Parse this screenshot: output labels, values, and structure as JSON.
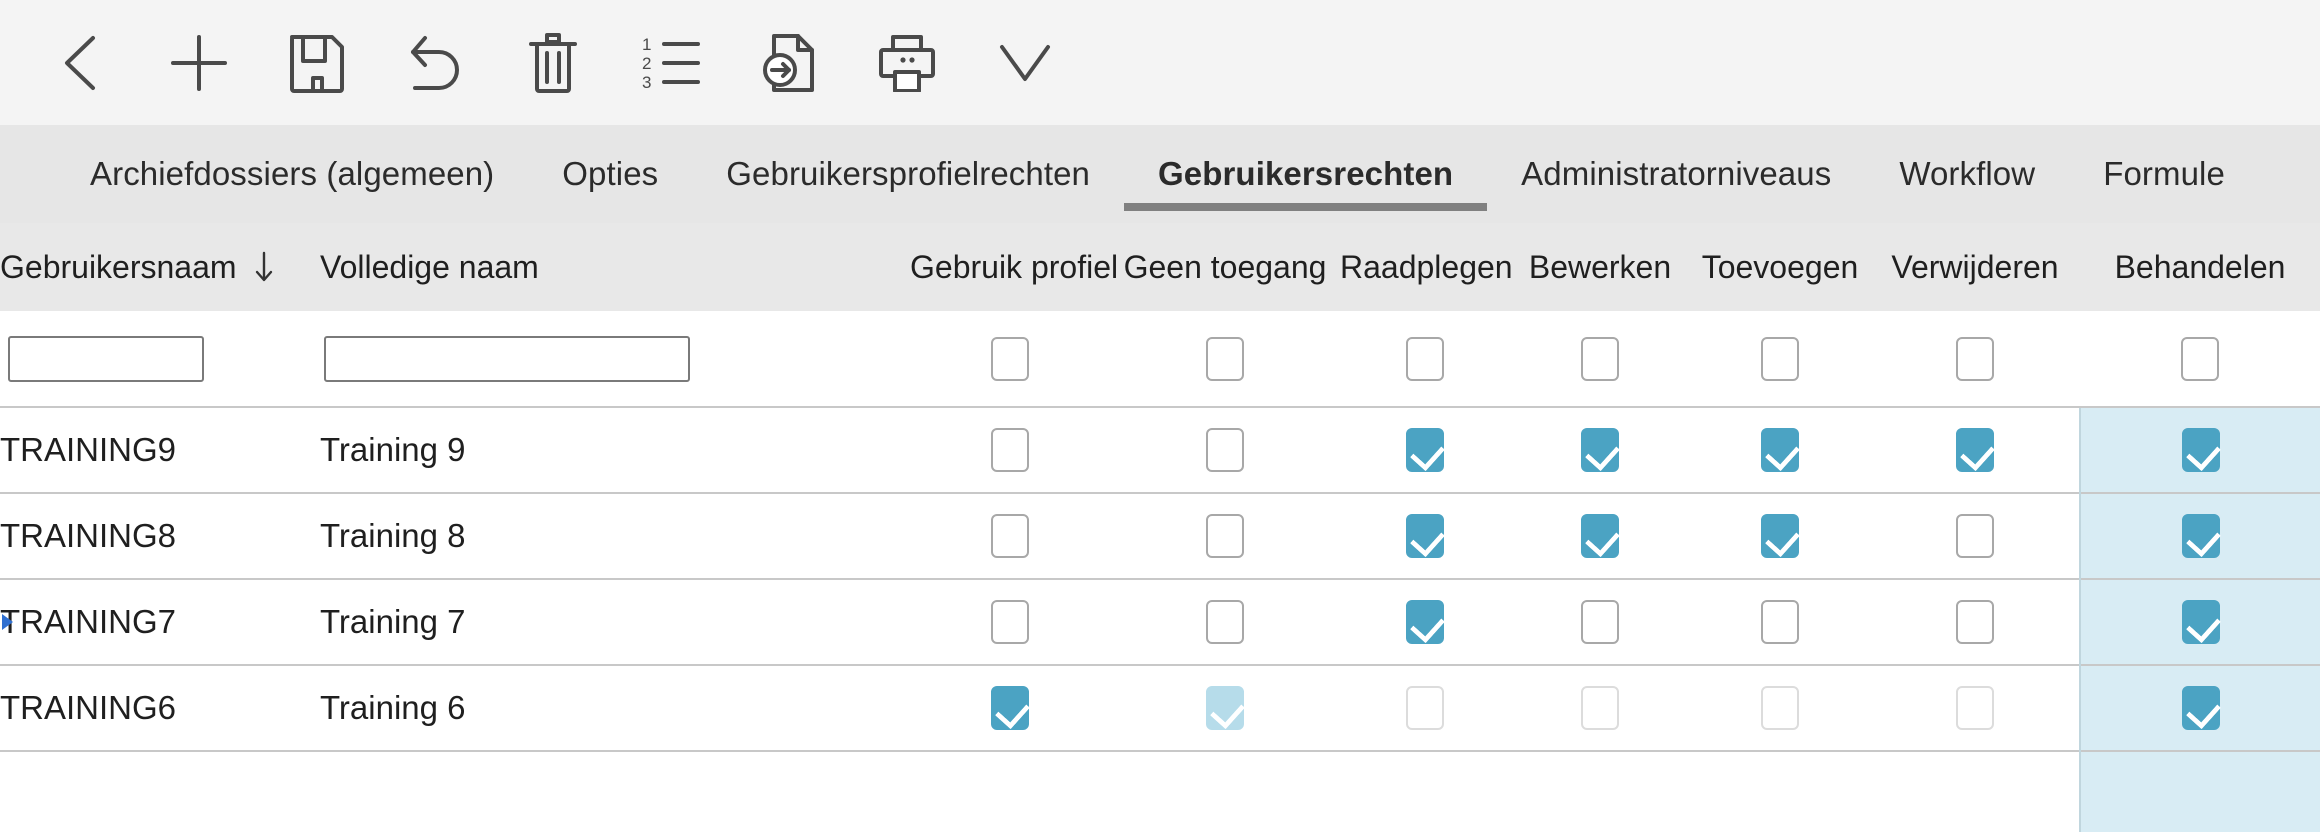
{
  "toolbar": {
    "buttons": [
      {
        "name": "back-icon",
        "title": "Terug"
      },
      {
        "name": "add-icon",
        "title": "Toevoegen"
      },
      {
        "name": "save-icon",
        "title": "Opslaan"
      },
      {
        "name": "undo-icon",
        "title": "Ongedaan maken"
      },
      {
        "name": "trash-icon",
        "title": "Verwijderen"
      },
      {
        "name": "numbered-list-icon",
        "title": "Nummering"
      },
      {
        "name": "export-document-icon",
        "title": "Exporteren"
      },
      {
        "name": "print-icon",
        "title": "Afdrukken"
      },
      {
        "name": "chevron-down-icon",
        "title": "Meer"
      }
    ]
  },
  "tabs": [
    {
      "label": "Archiefdossiers (algemeen)",
      "active": false
    },
    {
      "label": "Opties",
      "active": false
    },
    {
      "label": "Gebruikersprofielrechten",
      "active": false
    },
    {
      "label": "Gebruikersrechten",
      "active": true
    },
    {
      "label": "Administratorniveaus",
      "active": false
    },
    {
      "label": "Workflow",
      "active": false
    },
    {
      "label": "Formule",
      "active": false
    }
  ],
  "grid": {
    "columns": [
      {
        "key": "username",
        "label": "Gebruikersnaam",
        "type": "text",
        "sort": "desc"
      },
      {
        "key": "fullname",
        "label": "Volledige naam",
        "type": "text",
        "sort": null
      },
      {
        "key": "profile",
        "label": "Gebruik profiel",
        "type": "checkbox",
        "selected": false
      },
      {
        "key": "noaccess",
        "label": "Geen toegang",
        "type": "checkbox",
        "selected": false
      },
      {
        "key": "consult",
        "label": "Raadplegen",
        "type": "checkbox",
        "selected": false
      },
      {
        "key": "edit",
        "label": "Bewerken",
        "type": "checkbox",
        "selected": false
      },
      {
        "key": "add",
        "label": "Toevoegen",
        "type": "checkbox",
        "selected": false
      },
      {
        "key": "delete",
        "label": "Verwijderen",
        "type": "checkbox",
        "selected": false
      },
      {
        "key": "handle",
        "label": "Behandelen",
        "type": "checkbox",
        "selected": true
      }
    ],
    "filter_row": {
      "username_value": "",
      "username_placeholder": "",
      "fullname_value": "",
      "fullname_placeholder": "",
      "checkboxes": [
        {
          "checked": false,
          "disabled": false
        },
        {
          "checked": false,
          "disabled": false
        },
        {
          "checked": false,
          "disabled": false
        },
        {
          "checked": false,
          "disabled": false
        },
        {
          "checked": false,
          "disabled": false
        },
        {
          "checked": false,
          "disabled": false
        },
        {
          "checked": false,
          "disabled": false
        }
      ]
    },
    "rows": [
      {
        "marker": false,
        "username": "TRAINING9",
        "fullname": "Training 9",
        "checkboxes": [
          {
            "checked": false,
            "disabled": false,
            "faded": false
          },
          {
            "checked": false,
            "disabled": false,
            "faded": false
          },
          {
            "checked": true,
            "disabled": false,
            "faded": false
          },
          {
            "checked": true,
            "disabled": false,
            "faded": false
          },
          {
            "checked": true,
            "disabled": false,
            "faded": false
          },
          {
            "checked": true,
            "disabled": false,
            "faded": false
          },
          {
            "checked": true,
            "disabled": false,
            "faded": false
          }
        ]
      },
      {
        "marker": false,
        "username": "TRAINING8",
        "fullname": "Training 8",
        "checkboxes": [
          {
            "checked": false,
            "disabled": false,
            "faded": false
          },
          {
            "checked": false,
            "disabled": false,
            "faded": false
          },
          {
            "checked": true,
            "disabled": false,
            "faded": false
          },
          {
            "checked": true,
            "disabled": false,
            "faded": false
          },
          {
            "checked": true,
            "disabled": false,
            "faded": false
          },
          {
            "checked": false,
            "disabled": false,
            "faded": false
          },
          {
            "checked": true,
            "disabled": false,
            "faded": false
          }
        ]
      },
      {
        "marker": true,
        "username": "TRAINING7",
        "fullname": "Training 7",
        "checkboxes": [
          {
            "checked": false,
            "disabled": false,
            "faded": false
          },
          {
            "checked": false,
            "disabled": false,
            "faded": false
          },
          {
            "checked": true,
            "disabled": false,
            "faded": false
          },
          {
            "checked": false,
            "disabled": false,
            "faded": false
          },
          {
            "checked": false,
            "disabled": false,
            "faded": false
          },
          {
            "checked": false,
            "disabled": false,
            "faded": false
          },
          {
            "checked": true,
            "disabled": false,
            "faded": false
          }
        ]
      },
      {
        "marker": false,
        "username": "TRAINING6",
        "fullname": "Training 6",
        "checkboxes": [
          {
            "checked": true,
            "disabled": false,
            "faded": false
          },
          {
            "checked": true,
            "disabled": true,
            "faded": true
          },
          {
            "checked": false,
            "disabled": true,
            "faded": false
          },
          {
            "checked": false,
            "disabled": true,
            "faded": false
          },
          {
            "checked": false,
            "disabled": true,
            "faded": false
          },
          {
            "checked": false,
            "disabled": true,
            "faded": false
          },
          {
            "checked": true,
            "disabled": false,
            "faded": false
          }
        ]
      },
      {
        "marker": false,
        "username": "",
        "fullname": "",
        "partial": true,
        "checkboxes": [
          {
            "checked": false,
            "disabled": false,
            "faded": false
          },
          {
            "checked": false,
            "disabled": false,
            "faded": false
          },
          {
            "checked": false,
            "disabled": false,
            "faded": false
          },
          {
            "checked": false,
            "disabled": false,
            "faded": false
          },
          {
            "checked": false,
            "disabled": false,
            "faded": false
          },
          {
            "checked": false,
            "disabled": false,
            "faded": false
          },
          {
            "checked": false,
            "disabled": false,
            "faded": false
          }
        ]
      }
    ]
  },
  "colors": {
    "accent": "#4ba3c3",
    "accent_faded": "#b6dcea",
    "column_highlight": "#d8ecf4",
    "toolbar_bg": "#f4f4f4",
    "tabbar_bg": "#e6e6e6",
    "header_bg": "#e8e8e8",
    "marker": "#2f6fd0"
  }
}
